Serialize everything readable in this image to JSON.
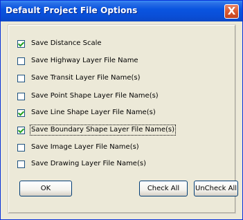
{
  "dialog": {
    "title": "Default Project File Options",
    "close_label": "X"
  },
  "options": [
    {
      "label": "Save Distance Scale",
      "checked": true
    },
    {
      "label": "Save Highway Layer File Name",
      "checked": false
    },
    {
      "label": "Save Transit Layer File Name(s)",
      "checked": false
    },
    {
      "label": "Save Point Shape Layer File Name(s)",
      "checked": false
    },
    {
      "label": "Save Line Shape Layer File Name(s)",
      "checked": true
    },
    {
      "label": "Save Boundary Shape Layer File Name(s)",
      "checked": true,
      "focused": true
    },
    {
      "label": "Save Image Layer File Name(s)",
      "checked": false
    },
    {
      "label": "Save Drawing Layer File Name(s)",
      "checked": false
    }
  ],
  "buttons": {
    "ok": "OK",
    "check_all": "Check All",
    "uncheck_all": "UnCheck All"
  },
  "colors": {
    "titlebar": "#0a55e0",
    "dialog_bg": "#ece9d8",
    "close_button": "#d9592f",
    "check_mark": "#21a121"
  }
}
